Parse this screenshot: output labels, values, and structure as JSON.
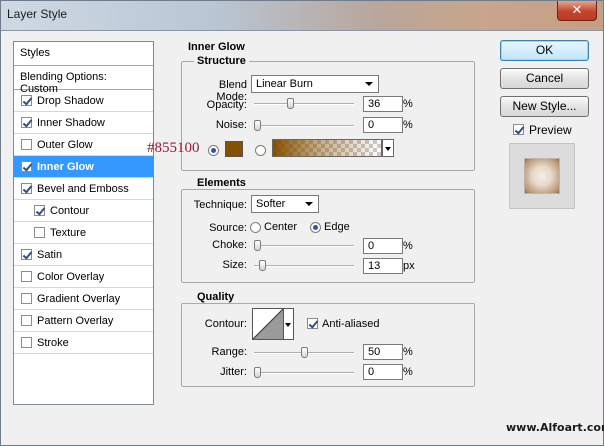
{
  "window": {
    "title": "Layer Style",
    "close_glyph": "✕"
  },
  "styles_panel": {
    "header": "Styles",
    "blending": "Blending Options: Custom",
    "items": [
      {
        "label": "Drop Shadow",
        "checked": true,
        "indent": false,
        "selected": false
      },
      {
        "label": "Inner Shadow",
        "checked": true,
        "indent": false,
        "selected": false
      },
      {
        "label": "Outer Glow",
        "checked": false,
        "indent": false,
        "selected": false
      },
      {
        "label": "Inner Glow",
        "checked": true,
        "indent": false,
        "selected": true
      },
      {
        "label": "Bevel and Emboss",
        "checked": true,
        "indent": false,
        "selected": false
      },
      {
        "label": "Contour",
        "checked": true,
        "indent": true,
        "selected": false
      },
      {
        "label": "Texture",
        "checked": false,
        "indent": true,
        "selected": false
      },
      {
        "label": "Satin",
        "checked": true,
        "indent": false,
        "selected": false
      },
      {
        "label": "Color Overlay",
        "checked": false,
        "indent": false,
        "selected": false
      },
      {
        "label": "Gradient Overlay",
        "checked": false,
        "indent": false,
        "selected": false
      },
      {
        "label": "Pattern Overlay",
        "checked": false,
        "indent": false,
        "selected": false
      },
      {
        "label": "Stroke",
        "checked": false,
        "indent": false,
        "selected": false
      }
    ]
  },
  "inner_glow": {
    "title": "Inner Glow",
    "structure": {
      "title": "Structure",
      "blend_mode_label": "Blend Mode:",
      "blend_mode_value": "Linear Burn",
      "opacity_label": "Opacity:",
      "opacity_value": "36",
      "opacity_unit": "%",
      "opacity_level": 0.36,
      "noise_label": "Noise:",
      "noise_value": "0",
      "noise_unit": "%",
      "noise_level": 0,
      "color_annotation": "#855100",
      "glow_color": "#855100"
    },
    "elements": {
      "title": "Elements",
      "technique_label": "Technique:",
      "technique_value": "Softer",
      "source_label": "Source:",
      "source_center": "Center",
      "source_edge": "Edge",
      "source_selected": "edge",
      "choke_label": "Choke:",
      "choke_value": "0",
      "choke_unit": "%",
      "choke_level": 0,
      "size_label": "Size:",
      "size_value": "13",
      "size_unit": "px",
      "size_level": 0.052
    },
    "quality": {
      "title": "Quality",
      "contour_label": "Contour:",
      "anti_aliased_label": "Anti-aliased",
      "anti_aliased_checked": true,
      "range_label": "Range:",
      "range_value": "50",
      "range_unit": "%",
      "range_level": 0.5,
      "jitter_label": "Jitter:",
      "jitter_value": "0",
      "jitter_unit": "%",
      "jitter_level": 0
    }
  },
  "buttons": {
    "ok": "OK",
    "cancel": "Cancel",
    "new_style": "New Style...",
    "preview_label": "Preview",
    "preview_checked": true
  },
  "watermark": "www.Alfoart.com"
}
